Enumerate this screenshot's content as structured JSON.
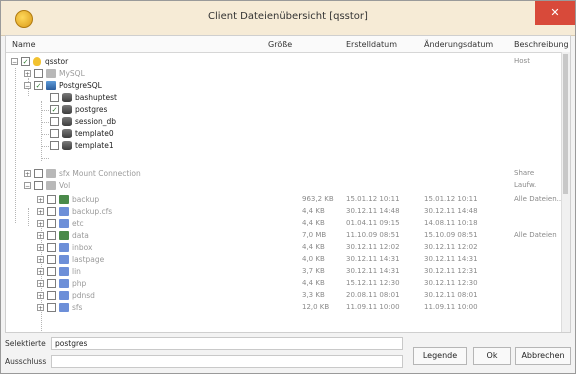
{
  "window": {
    "title": "Client Dateienübersicht [qsstor]"
  },
  "columns": {
    "name": "Name",
    "size": "Größe",
    "created": "Erstelldatum",
    "modified": "Änderungsdatum",
    "description": "Beschreibung"
  },
  "tree": {
    "root": {
      "label": "qsstor",
      "description": "Host"
    },
    "mysql": {
      "label": "MySQL"
    },
    "postgres_group": {
      "label": "PostgreSQL"
    },
    "dbs": [
      {
        "label": "bashuptest",
        "checked": false
      },
      {
        "label": "postgres",
        "checked": true
      },
      {
        "label": "session_db",
        "checked": false
      },
      {
        "label": "template0",
        "checked": false
      },
      {
        "label": "template1",
        "checked": false
      }
    ],
    "share1": {
      "label": "sfx Mount Connection",
      "description": "Share"
    },
    "share2": {
      "label": "Vol",
      "description": "Laufw."
    },
    "folders": [
      {
        "label": "backup",
        "size": "963,2 KB",
        "created": "15.01.12 10:11",
        "modified": "15.01.12 10:11",
        "description": "Alle Dateien..."
      },
      {
        "label": "backup.cfs",
        "size": "4,4 KB",
        "created": "30.12.11 14:48",
        "modified": "30.12.11 14:48",
        "description": ""
      },
      {
        "label": "etc",
        "size": "4,4 KB",
        "created": "01.04.11 09:15",
        "modified": "14.08.11 10:18",
        "description": ""
      },
      {
        "label": "data",
        "size": "7,0 MB",
        "created": "11.10.09 08:51",
        "modified": "15.10.09 08:51",
        "description": "Alle Dateien"
      },
      {
        "label": "inbox",
        "size": "4,4 KB",
        "created": "30.12.11 12:02",
        "modified": "30.12.11 12:02",
        "description": ""
      },
      {
        "label": "lastpage",
        "size": "4,0 KB",
        "created": "30.12.11 14:31",
        "modified": "30.12.11 14:31",
        "description": ""
      },
      {
        "label": "lin",
        "size": "3,7 KB",
        "created": "30.12.11 14:31",
        "modified": "30.12.11 12:31",
        "description": ""
      },
      {
        "label": "php",
        "size": "4,4 KB",
        "created": "15.12.11 12:30",
        "modified": "30.12.11 12:30",
        "description": ""
      },
      {
        "label": "pdnsd",
        "size": "3,3 KB",
        "created": "20.08.11 08:01",
        "modified": "30.12.11 08:01",
        "description": ""
      },
      {
        "label": "sfs",
        "size": "12,0 KB",
        "created": "11.09.11 10:00",
        "modified": "11.09.11 10:00",
        "description": ""
      }
    ]
  },
  "footer": {
    "selected_label": "Selektierte",
    "selected_value": "postgres",
    "excluded_label": "Ausschluss",
    "excluded_value": "",
    "legend_button": "Legende",
    "ok_button": "Ok",
    "cancel_button": "Abbrechen"
  }
}
